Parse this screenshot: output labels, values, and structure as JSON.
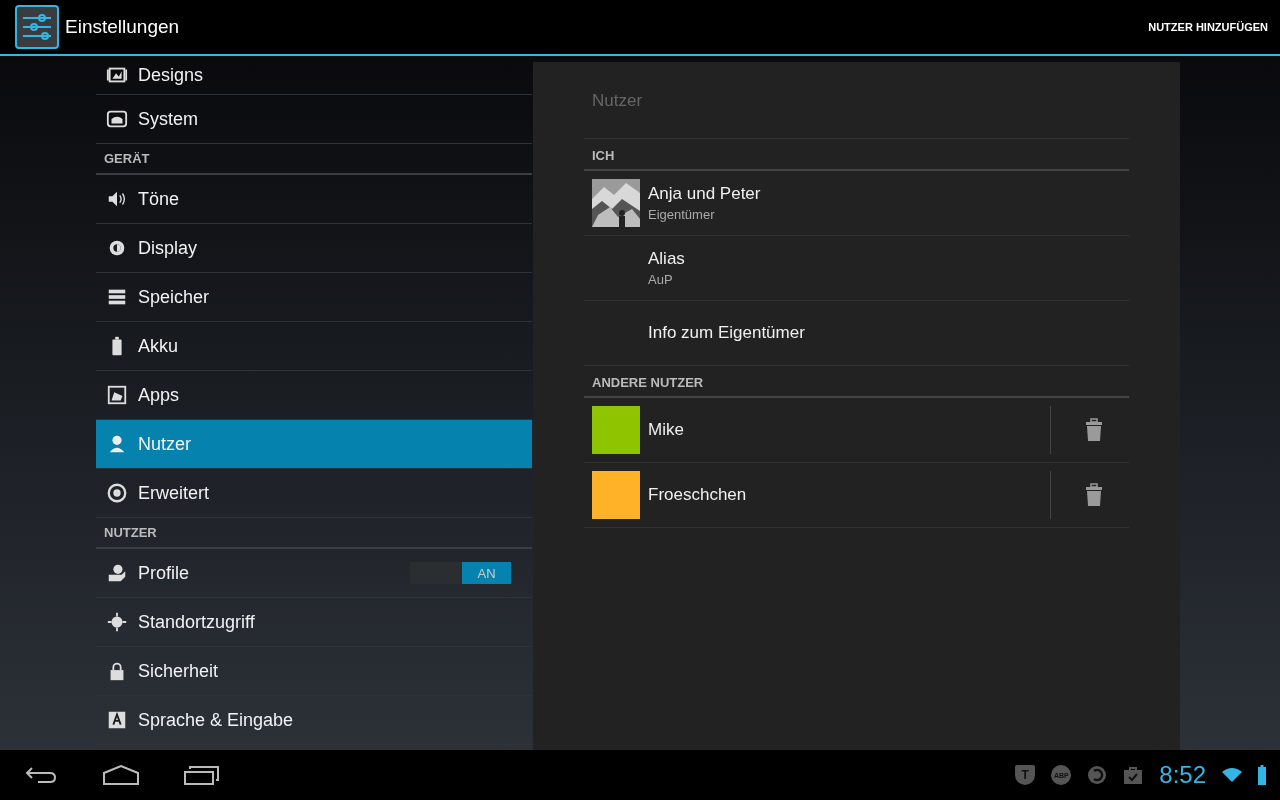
{
  "action_bar": {
    "title": "Einstellungen",
    "action": "NUTZER HINZUFÜGEN"
  },
  "sidebar": {
    "items": [
      {
        "kind": "item",
        "label": "Designs",
        "selected": false
      },
      {
        "kind": "item",
        "label": "System",
        "selected": false
      },
      {
        "kind": "header",
        "label": "GERÄT"
      },
      {
        "kind": "item",
        "label": "Töne",
        "selected": false
      },
      {
        "kind": "item",
        "label": "Display",
        "selected": false
      },
      {
        "kind": "item",
        "label": "Speicher",
        "selected": false
      },
      {
        "kind": "item",
        "label": "Akku",
        "selected": false
      },
      {
        "kind": "item",
        "label": "Apps",
        "selected": false
      },
      {
        "kind": "item",
        "label": "Nutzer",
        "selected": true
      },
      {
        "kind": "item",
        "label": "Erweitert",
        "selected": false
      },
      {
        "kind": "header",
        "label": "NUTZER"
      },
      {
        "kind": "toggle",
        "label": "Profile",
        "selected": false,
        "on": true,
        "toggle_label": "AN"
      },
      {
        "kind": "item",
        "label": "Standortzugriff",
        "selected": false
      },
      {
        "kind": "item",
        "label": "Sicherheit",
        "selected": false
      },
      {
        "kind": "item",
        "label": "Sprache & Eingabe",
        "selected": false
      }
    ]
  },
  "detail": {
    "title": "Nutzer",
    "sections": [
      {
        "header": "ICH",
        "rows": [
          {
            "kind": "owner",
            "title": "Anja und Peter",
            "subtitle": "Eigentümer"
          },
          {
            "kind": "text",
            "title": "Alias",
            "subtitle": "AuP"
          },
          {
            "kind": "text",
            "title": "Info zum Eigentümer"
          }
        ]
      },
      {
        "header": "ANDERE NUTZER",
        "rows": [
          {
            "kind": "user",
            "title": "Mike",
            "color": "#8fc400"
          },
          {
            "kind": "user",
            "title": "Froeschchen",
            "color": "#ffb128"
          }
        ]
      }
    ]
  },
  "status_bar": {
    "abp_label": "ABP",
    "shield_label": "T",
    "time": "8:52"
  }
}
